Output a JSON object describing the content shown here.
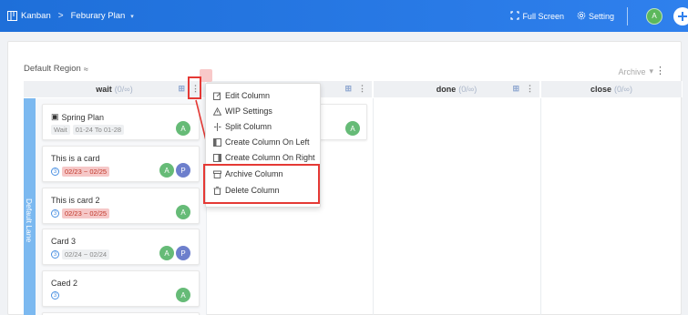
{
  "topbar": {
    "app": "Kanban",
    "separator": ">",
    "plan": "Feburary Plan",
    "full_screen": "Full Screen",
    "setting": "Setting",
    "avatar": "A"
  },
  "region": {
    "title": "Default Region",
    "archive_label": "Archive"
  },
  "lane": {
    "label": "Default Lane"
  },
  "columns": [
    {
      "name": "wait",
      "wip": "(0/∞)"
    },
    {
      "name": "",
      "wip": ""
    },
    {
      "name": "done",
      "wip": "(0/∞)"
    },
    {
      "name": "close",
      "wip": "(0/∞)"
    }
  ],
  "cards": [
    {
      "title": "Spring Plan",
      "status": "Wait",
      "dates": "01-24 To 01-28",
      "avatars": [
        "A"
      ]
    },
    {
      "title": "This is a card",
      "num": "3",
      "dates": "02/23 ~ 02/25",
      "avatars": [
        "A",
        "P"
      ]
    },
    {
      "title": "This is card 2",
      "num": "3",
      "dates": "02/23 ~ 02/25",
      "avatars": [
        "A"
      ]
    },
    {
      "title": "Card 3",
      "num": "3",
      "dates": "02/24 ~ 02/24",
      "avatars": [
        "A",
        "P"
      ]
    },
    {
      "title": "Caed 2",
      "num": "3",
      "avatars": [
        "A"
      ]
    }
  ],
  "col2_card": {
    "avatars": [
      "A"
    ]
  },
  "menu": {
    "items": [
      {
        "label": "Edit Column",
        "icon": "edit-icon"
      },
      {
        "label": "WIP Settings",
        "icon": "warning-icon"
      },
      {
        "label": "Split Column",
        "icon": "split-icon"
      },
      {
        "label": "Create Column On Left",
        "icon": "column-left-icon"
      },
      {
        "label": "Create Column On Right",
        "icon": "column-right-icon"
      },
      {
        "label": "Archive Column",
        "icon": "archive-icon"
      },
      {
        "label": "Delete Column",
        "icon": "trash-icon"
      }
    ]
  },
  "colors": {
    "topbar": "#2f80ed",
    "lane": "#7cb9f0",
    "highlight": "#e53935",
    "avatar_a": "#66bb77",
    "avatar_p": "#6d7fcc"
  }
}
